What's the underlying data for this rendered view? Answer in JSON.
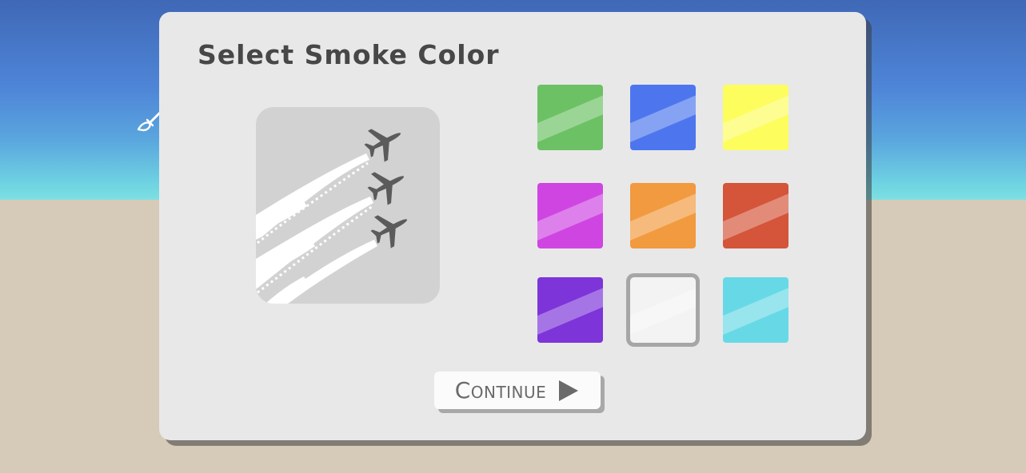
{
  "panel": {
    "title": "Select Smoke Color",
    "preview_icon": "jet-formation-smoke-icon",
    "continue_label": "Continue",
    "continue_icon": "play-arrow-icon"
  },
  "hud": {
    "paint_icon": "paint-brush-icon"
  },
  "colors": {
    "sky": "#4f86d8",
    "ground": "#d6cbb8",
    "panel": "#e8e8e9",
    "text": "#474747"
  },
  "swatches": [
    {
      "name": "green",
      "color": "#6cc164",
      "selected": false
    },
    {
      "name": "blue",
      "color": "#4d76ee",
      "selected": false
    },
    {
      "name": "yellow",
      "color": "#fdfd5d",
      "selected": false
    },
    {
      "name": "magenta",
      "color": "#cf45e2",
      "selected": false
    },
    {
      "name": "orange",
      "color": "#f29a3f",
      "selected": false
    },
    {
      "name": "red",
      "color": "#d4553a",
      "selected": false
    },
    {
      "name": "purple",
      "color": "#7d34d9",
      "selected": false
    },
    {
      "name": "white",
      "color": "#f3f3f3",
      "selected": true
    },
    {
      "name": "cyan",
      "color": "#67d9e6",
      "selected": false
    }
  ]
}
